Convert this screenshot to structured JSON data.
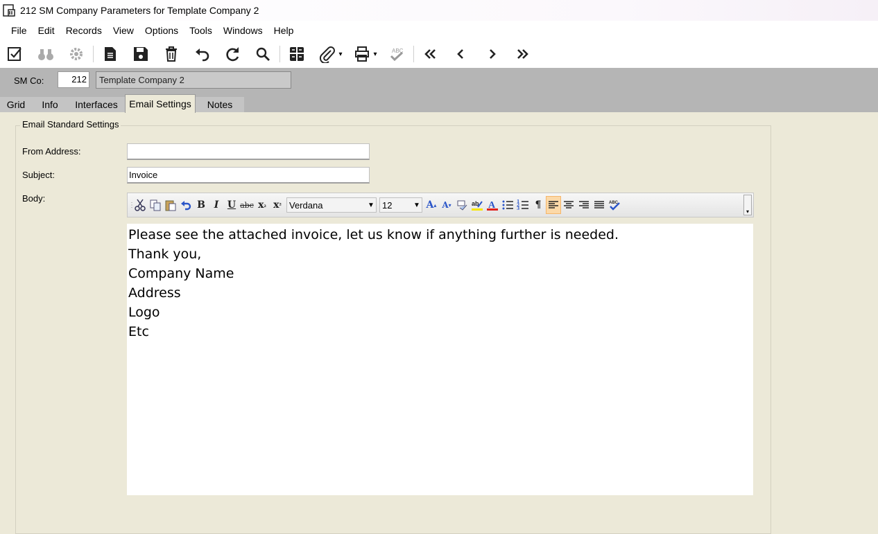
{
  "window": {
    "title": "212 SM Company Parameters for Template Company 2"
  },
  "menu": [
    "File",
    "Edit",
    "Records",
    "View",
    "Options",
    "Tools",
    "Windows",
    "Help"
  ],
  "toolbar": {
    "icons": [
      "checklist-icon",
      "binoculars-icon",
      "settings-gear-icon",
      "new-document-icon",
      "save-icon",
      "delete-icon",
      "undo-icon",
      "refresh-icon",
      "search-icon",
      "grid-icon",
      "attachment-icon",
      "print-icon",
      "spellcheck-icon",
      "first-record-icon",
      "previous-record-icon",
      "next-record-icon",
      "last-record-icon"
    ]
  },
  "header": {
    "co_label": "SM Co:",
    "co_number": "212",
    "co_name": "Template Company 2"
  },
  "tabs": [
    {
      "label": "Grid"
    },
    {
      "label": "Info"
    },
    {
      "label": "Interfaces"
    },
    {
      "label": "Email Settings",
      "active": true
    },
    {
      "label": "Notes"
    }
  ],
  "email": {
    "group_title": "Email Standard Settings",
    "from_label": "From Address:",
    "from_value": "",
    "subject_label": "Subject:",
    "subject_value": "Invoice",
    "body_label": "Body:",
    "font_name": "Verdana",
    "font_size": "12",
    "body_lines": [
      "Please see the attached invoice, let us know if anything further is needed.",
      "",
      "Thank you,",
      "",
      "Company Name",
      "Address",
      "Logo",
      "Etc"
    ]
  },
  "colors": {
    "panel": "#ece9d8",
    "header_band": "#b5b5b5",
    "active_align": "#fcd9a8"
  }
}
